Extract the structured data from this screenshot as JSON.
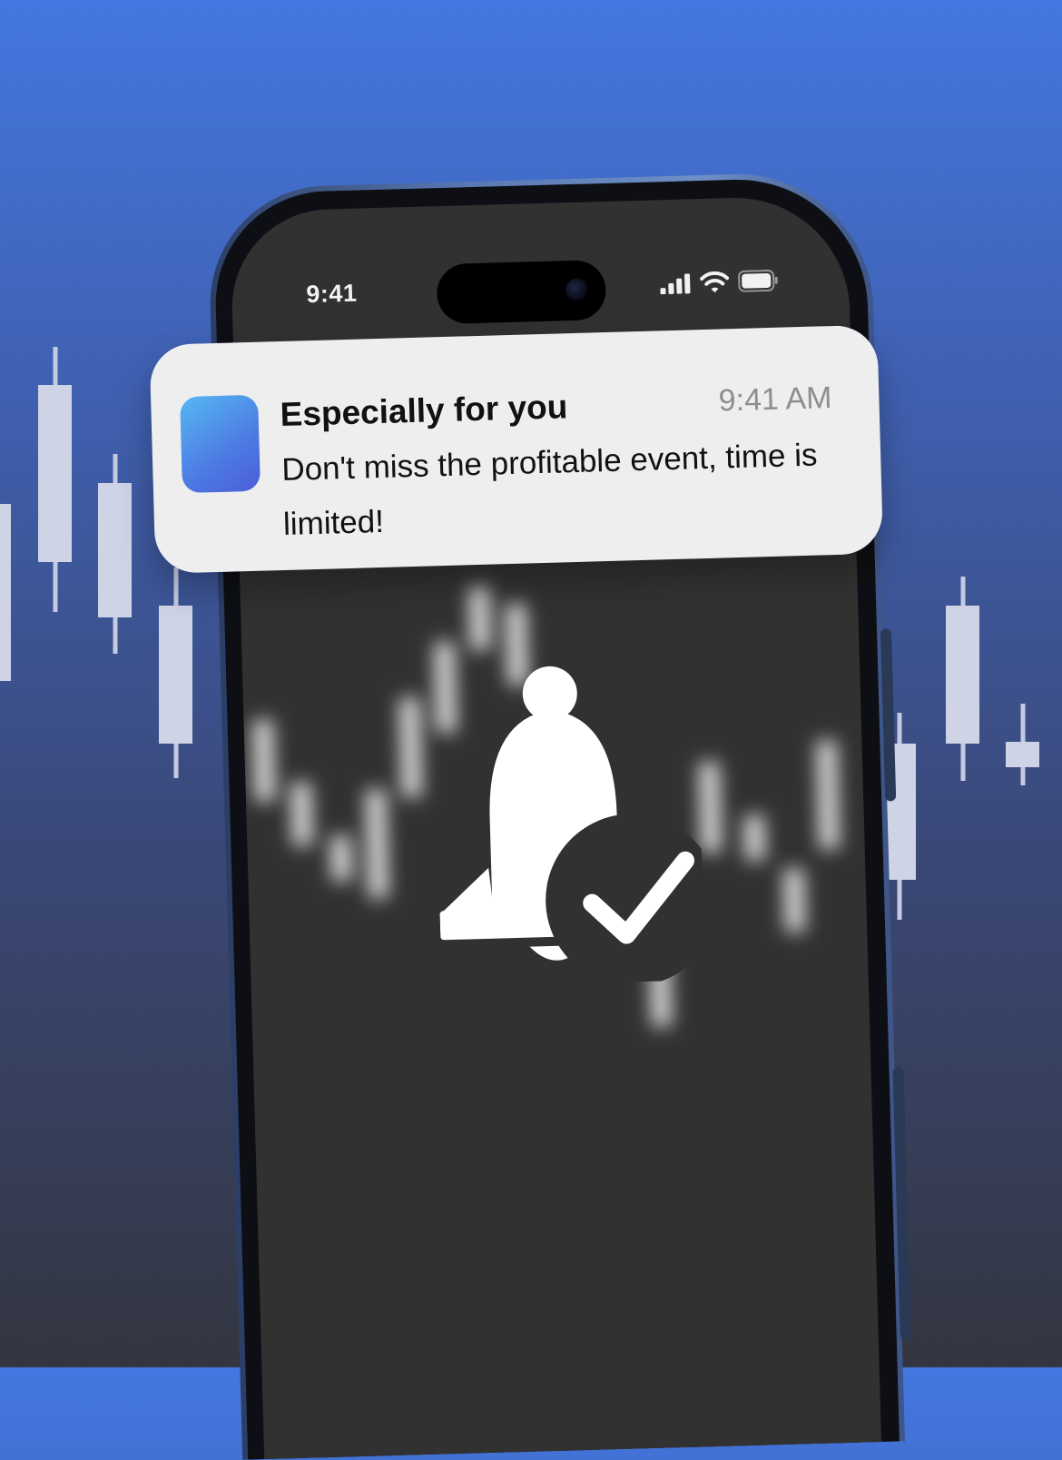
{
  "status_bar": {
    "time": "9:41"
  },
  "notification": {
    "title": "Especially for you",
    "time": "9:41 AM",
    "message": "Don't miss the profitable event, time is limited!"
  },
  "icons": [
    "app-icon",
    "cellular-signal-icon",
    "wifi-icon",
    "battery-icon",
    "bell-check-icon"
  ],
  "colors": {
    "background_top": "#4477e0",
    "background_bottom": "#333640",
    "candles": "#ced4e6",
    "notification_bg": "#eeeeef",
    "app_icon_start": "#56b8f3",
    "app_icon_end": "#4a5ed6"
  }
}
